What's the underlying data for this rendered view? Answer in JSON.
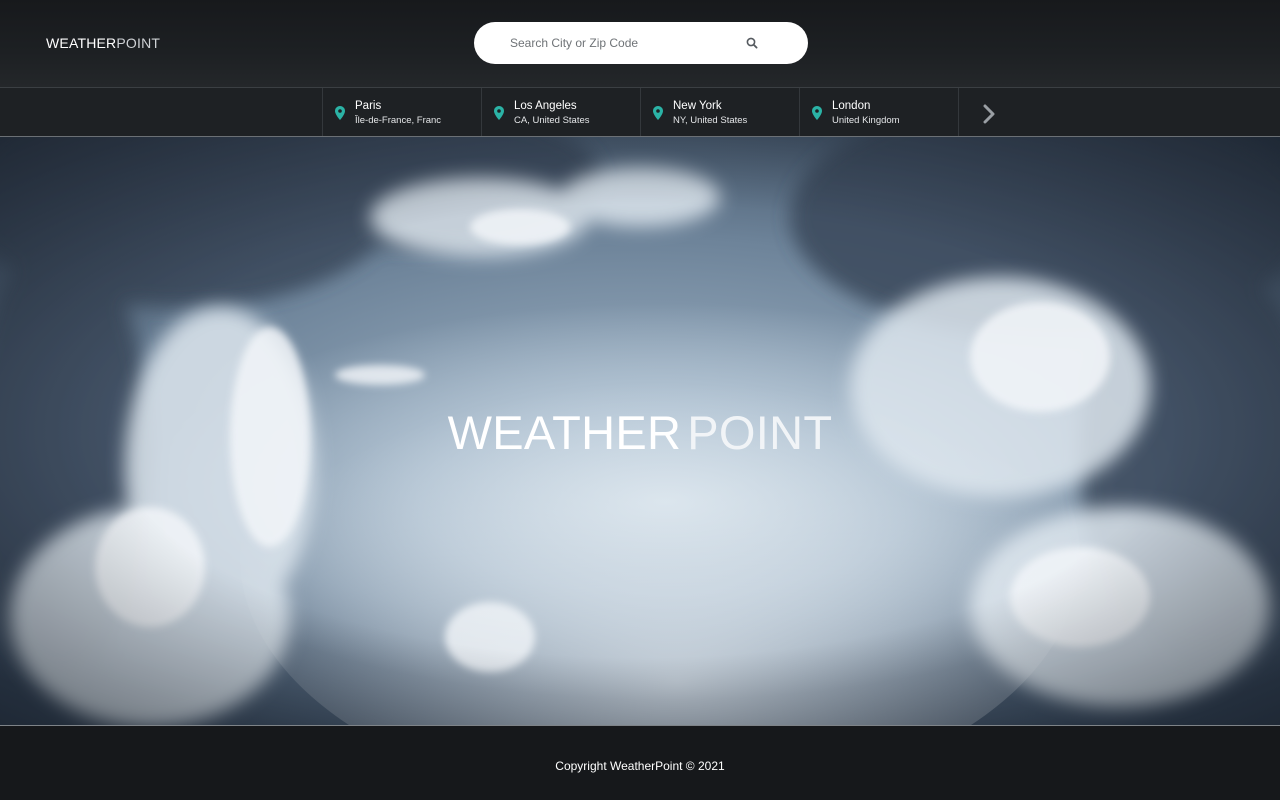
{
  "header": {
    "logo_bold": "WEATHER",
    "logo_light": "POINT"
  },
  "search": {
    "placeholder": "Search City or Zip Code",
    "icon": "search-icon"
  },
  "cities": [
    {
      "name": "Paris",
      "region": "Île-de-France, France"
    },
    {
      "name": "Los Angeles",
      "region": "CA, United States"
    },
    {
      "name": "New York",
      "region": "NY, United States"
    },
    {
      "name": "London",
      "region": "United Kingdom"
    }
  ],
  "cities_nav": {
    "icon": "chevron-right-icon"
  },
  "hero": {
    "title_bold": "WEATHER",
    "title_light": "POINT"
  },
  "footer": {
    "copyright": "Copyright WeatherPoint © 2021"
  },
  "colors": {
    "accent": "#2bb3a6",
    "background": "#15171a",
    "cities_bar": "#1e2124"
  }
}
